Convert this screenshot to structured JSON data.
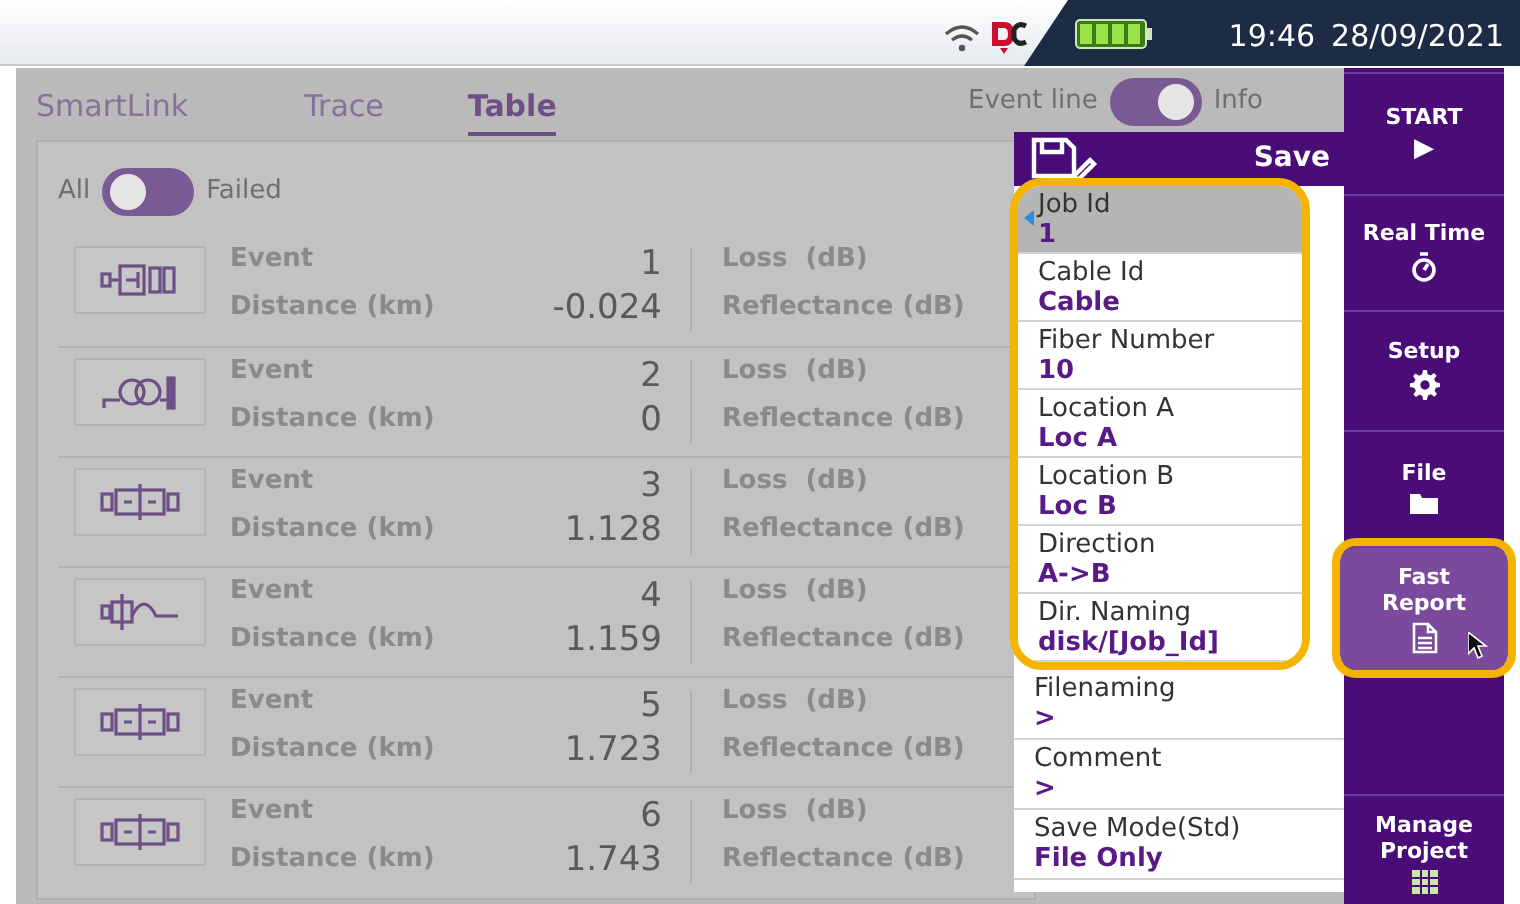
{
  "status_bar": {
    "time": "19:46",
    "date": "28/09/2021"
  },
  "tabs": [
    {
      "label": "SmartLink",
      "selected": false
    },
    {
      "label": "Trace",
      "selected": false
    },
    {
      "label": "Table",
      "selected": true
    }
  ],
  "view_toggle": {
    "left_label": "Event line",
    "right_label": "Info",
    "right_selected": true
  },
  "filter_toggle": {
    "left_label": "All",
    "right_label": "Failed",
    "right_selected": false
  },
  "events": [
    {
      "kind": "end",
      "event_label": "Event",
      "event": "1",
      "distance_label": "Distance (km)",
      "distance": "-0.024",
      "loss_label": "Loss  (dB)",
      "reflectance_label": "Reflectance (dB)"
    },
    {
      "kind": "coil",
      "event_label": "Event",
      "event": "2",
      "distance_label": "Distance (km)",
      "distance": "0",
      "loss_label": "Loss  (dB)",
      "reflectance_label": "Reflectance (dB)"
    },
    {
      "kind": "connector",
      "event_label": "Event",
      "event": "3",
      "distance_label": "Distance (km)",
      "distance": "1.128",
      "loss_label": "Loss  (dB)",
      "reflectance_label": "Reflectance (dB)"
    },
    {
      "kind": "reflection",
      "event_label": "Event",
      "event": "4",
      "distance_label": "Distance (km)",
      "distance": "1.159",
      "loss_label": "Loss  (dB)",
      "reflectance_label": "Reflectance (dB)"
    },
    {
      "kind": "connector",
      "event_label": "Event",
      "event": "5",
      "distance_label": "Distance (km)",
      "distance": "1.723",
      "loss_label": "Loss  (dB)",
      "reflectance_label": "Reflectance (dB)"
    },
    {
      "kind": "connector",
      "event_label": "Event",
      "event": "6",
      "distance_label": "Distance (km)",
      "distance": "1.743",
      "loss_label": "Loss  (dB)",
      "reflectance_label": "Reflectance (dB)"
    }
  ],
  "save_panel": {
    "title": "Save",
    "highlight_frame": true,
    "framed_fields": [
      {
        "label": "Job Id",
        "value": "1",
        "selected": true
      },
      {
        "label": "Cable Id",
        "value": "Cable",
        "selected": false
      },
      {
        "label": "Fiber Number",
        "value": "10",
        "selected": false
      },
      {
        "label": "Location A",
        "value": "Loc A",
        "selected": false
      },
      {
        "label": "Location B",
        "value": "Loc B",
        "selected": false
      },
      {
        "label": "Direction",
        "value": "A->B",
        "selected": false
      },
      {
        "label": "Dir. Naming",
        "value": "disk/[Job_Id]",
        "selected": false
      }
    ],
    "other_fields": [
      {
        "label": "Filenaming",
        "value": ">",
        "selected": false
      },
      {
        "label": "Comment",
        "value": ">",
        "selected": false
      },
      {
        "label": "Save Mode(Std)",
        "value": "File Only",
        "selected": false
      }
    ]
  },
  "sidebar": [
    {
      "kind": "play",
      "label": "START",
      "glyph": "▶",
      "highlighted": false
    },
    {
      "kind": "stopwatch",
      "label": "Real Time",
      "highlighted": false
    },
    {
      "kind": "gear",
      "label": "Setup",
      "highlighted": false
    },
    {
      "kind": "folder",
      "label": "File",
      "highlighted": false
    },
    {
      "kind": "document",
      "label": "Fast Report",
      "highlighted": true
    },
    {
      "kind": "empty"
    },
    {
      "kind": "grid",
      "label": "Manage Project",
      "highlighted": false
    }
  ]
}
